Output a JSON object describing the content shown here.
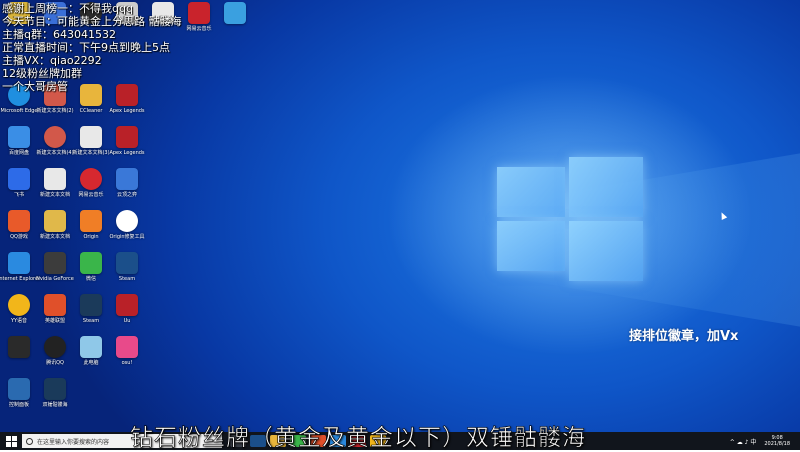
{
  "overlay_lines": [
    "感谢上周榜一：不得我qqq",
    "今天节目：可能黄金上分思路 骷髅海",
    "主播q群：643041532",
    "正常直播时间：下午9点到晚上5点",
    "主播VX：qiao2292",
    "12级粉丝牌加群",
    "一个大哥房管"
  ],
  "watermark": "接排位徽章，加Vx",
  "subtitle": "钻石粉丝牌（黄金及黄金以下）双锤骷髅海",
  "icons": [
    {
      "label": "",
      "color": "#d9b43a"
    },
    {
      "label": "",
      "color": "#3a6fd8"
    },
    {
      "label": "",
      "color": "#2b2b2b"
    },
    {
      "label": "",
      "color": "#cccccc"
    },
    {
      "label": "",
      "color": "#e8e8e8"
    },
    {
      "label": "网易云音乐",
      "color": "#c9232c"
    },
    {
      "label": "",
      "color": "#3aa0e0"
    },
    {
      "label": "Microsoft Edge",
      "color": "#1f8fe0"
    },
    {
      "label": "新建文本文档(2)",
      "color": "#d2584a"
    },
    {
      "label": "CCleaner",
      "color": "#e8b53c"
    },
    {
      "label": "Apex Legends",
      "color": "#b92128"
    },
    {
      "label": "百度网盘",
      "color": "#3a8ee6"
    },
    {
      "label": "新建文本文档(4)",
      "color": "#d2584a"
    },
    {
      "label": "新建文本文档(3)",
      "color": "#e8e8e8"
    },
    {
      "label": "Apex Legends",
      "color": "#b92128"
    },
    {
      "label": "飞书",
      "color": "#2d6be8"
    },
    {
      "label": "新建文本文档",
      "color": "#e8e8e8"
    },
    {
      "label": "网易云音乐",
      "color": "#d6282f"
    },
    {
      "label": "云顶之弈",
      "color": "#3a78d8"
    },
    {
      "label": "QQ游戏",
      "color": "#e85a2a"
    },
    {
      "label": "新建文本文档",
      "color": "#e0b84a"
    },
    {
      "label": "Origin",
      "color": "#f07e26"
    },
    {
      "label": "Origin修复工具",
      "color": "#ffffff"
    },
    {
      "label": "Internet Explorer",
      "color": "#2a8ae0"
    },
    {
      "label": "Nvidia GeForce",
      "color": "#3c3c3c"
    },
    {
      "label": "微信",
      "color": "#3ab54a"
    },
    {
      "label": "Steam",
      "color": "#1b4f8a"
    },
    {
      "label": "YY语音",
      "color": "#f2b61a"
    },
    {
      "label": "英雄联盟",
      "color": "#e0502a"
    },
    {
      "label": "Steam",
      "color": "#1b3a5a"
    },
    {
      "label": "Uu",
      "color": "#b92128"
    },
    {
      "label": "",
      "color": "#2a2a2a"
    },
    {
      "label": "腾讯QQ",
      "color": "#222222"
    },
    {
      "label": "此电脑",
      "color": "#8fc8e8"
    },
    {
      "label": "osu!",
      "color": "#e84a8a"
    },
    {
      "label": "控制面板",
      "color": "#2a6ab0"
    },
    {
      "label": "双锤骷髅海",
      "color": "#1a3a5a"
    }
  ],
  "taskbar": {
    "search_placeholder": "在这里输入你要搜索的内容",
    "time": "9:08",
    "date": "2021/8/18",
    "tray_symbols": "^ ☁ ♪ 中"
  }
}
